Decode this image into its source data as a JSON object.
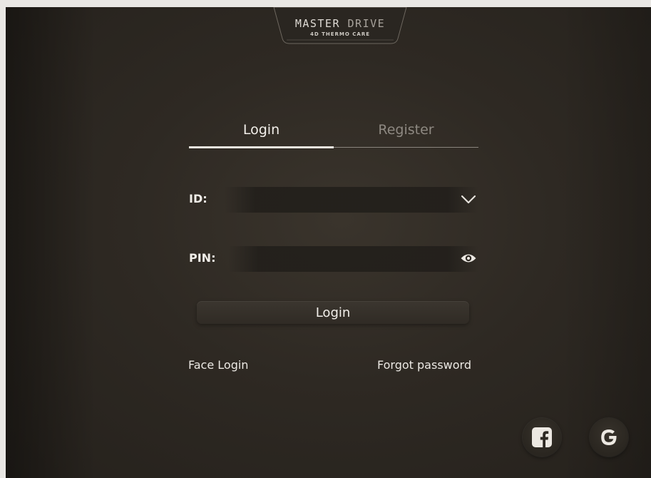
{
  "logo": {
    "title_main": "MASTER ",
    "title_accent": "DRIVE",
    "subtitle": "4D THERMO CARE"
  },
  "tabs": [
    {
      "label": "Login",
      "active": true
    },
    {
      "label": "Register",
      "active": false
    }
  ],
  "form": {
    "id_label": "ID:",
    "id_value": "",
    "pin_label": "PIN:",
    "pin_value": "",
    "login_button": "Login"
  },
  "links": {
    "face_login": "Face Login",
    "forgot_password": "Forgot password"
  },
  "icons": {
    "id_dropdown": "chevron-down-icon",
    "pin_reveal": "eye-icon",
    "facebook": "facebook-icon",
    "google": "google-icon"
  },
  "colors": {
    "background": "#2e2923",
    "text": "#f0ede8",
    "inactive_tab": "#8e8982"
  }
}
